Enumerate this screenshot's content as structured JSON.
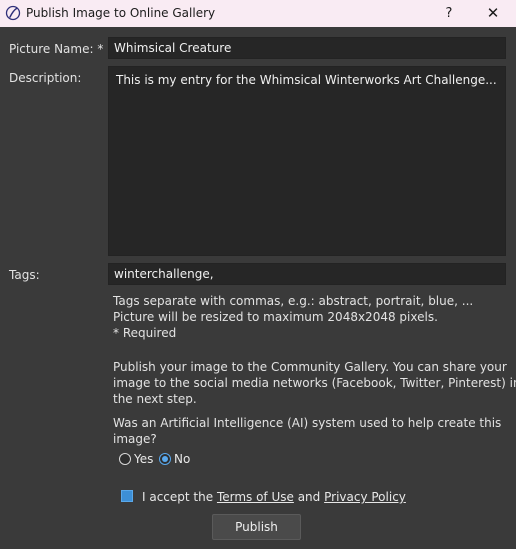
{
  "window": {
    "title": "Publish Image to Online Gallery",
    "help_label": "?",
    "close_label": "✕"
  },
  "form": {
    "picture_name_label": "Picture Name: *",
    "picture_name_value": "Whimsical Creature",
    "description_label": "Description:",
    "description_value": "This is my entry for the Whimsical Winterworks Art Challenge...",
    "tags_label": "Tags:",
    "tags_value": "winterchallenge,"
  },
  "hints": {
    "tags_hint": "Tags separate with commas, e.g.: abstract, portrait, blue, ...",
    "resize_hint": "Picture will be resized to maximum 2048x2048 pixels.",
    "required_hint": "* Required"
  },
  "publish_info": {
    "line1": "Publish your image to the Community Gallery. You can share your",
    "line2": "image to the social media networks (Facebook, Twitter, Pinterest) in",
    "line3": "the next step."
  },
  "ai_question": {
    "line1": "Was an Artificial Intelligence (AI) system used to help create this",
    "line2": "image?",
    "yes_label": "Yes",
    "no_label": "No",
    "selected": "No"
  },
  "terms": {
    "prefix": "I accept the ",
    "terms_link": "Terms of Use",
    "conjunction": " and ",
    "privacy_link": "Privacy Policy",
    "checked": true
  },
  "actions": {
    "publish_label": "Publish"
  },
  "colors": {
    "accent": "#3d8fd6",
    "dialog_bg": "#3a3a3a",
    "field_bg": "#262626",
    "titlebar_bg": "#f9ebf3"
  },
  "icons": {
    "app": "app-logo-icon",
    "help": "help-icon",
    "close": "close-icon"
  }
}
